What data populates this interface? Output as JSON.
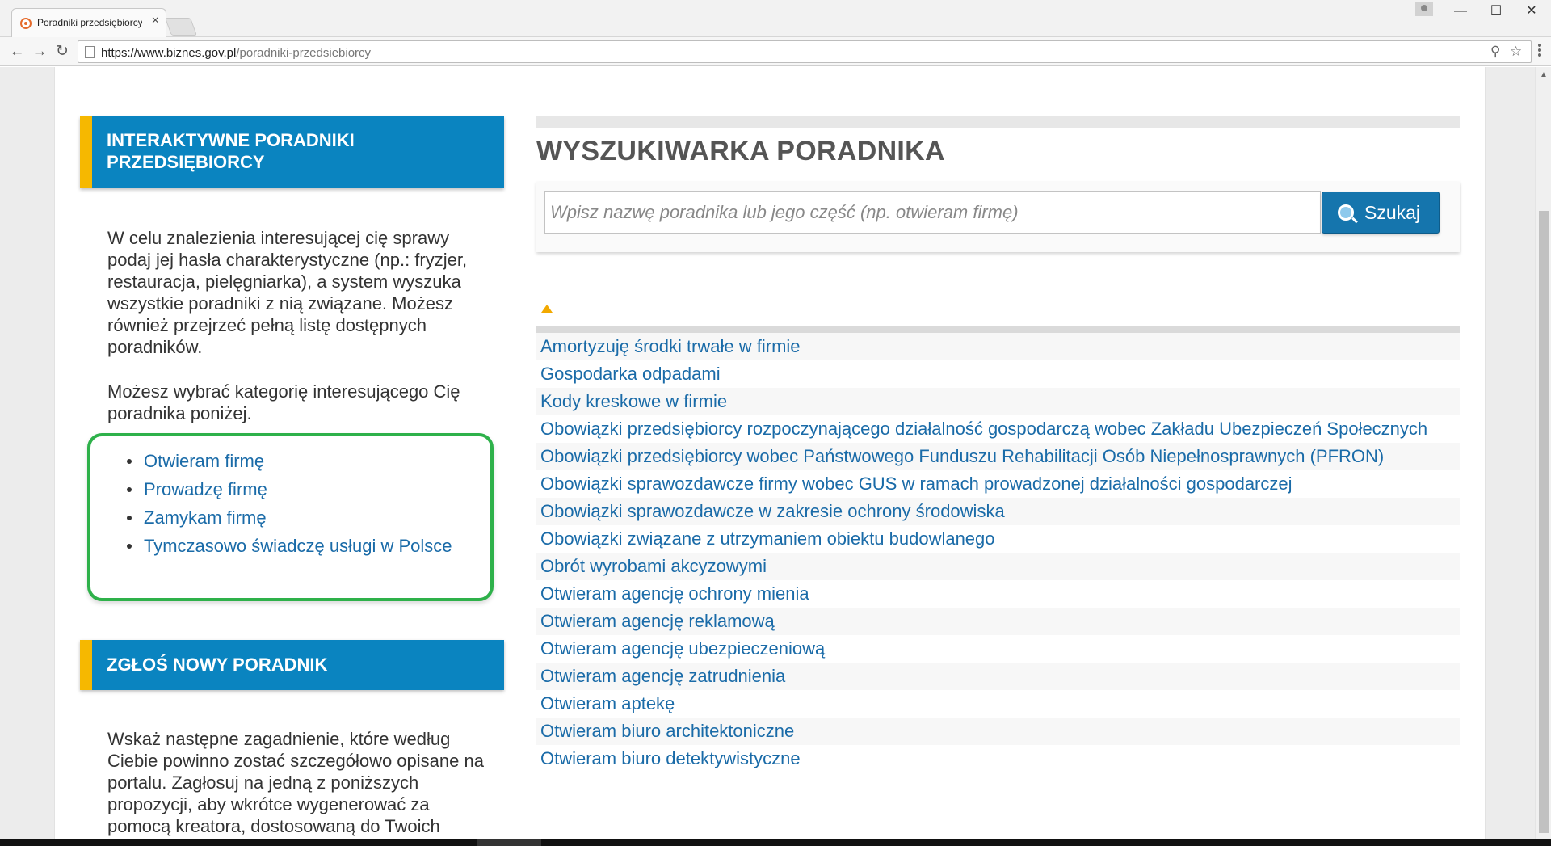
{
  "browser": {
    "tab_title": "Poradniki przedsiębiorcy |",
    "tab_close": "×",
    "url_host": "https://www.biznes.gov.pl",
    "url_path": "/poradniki-przedsiebiorcy",
    "back": "←",
    "forward": "→",
    "reload": "↻",
    "minimize": "—",
    "maximize": "☐",
    "close": "✕",
    "zoom_icon": "⚲",
    "star_icon": "☆"
  },
  "left": {
    "header1": "INTERAKTYWNE PORADNIKI PRZEDSIĘBIORCY",
    "intro": "W celu znalezienia interesującej cię sprawy podaj jej hasła charakterystyczne (np.: fryzjer, restauracja, pielęgniarka), a system wyszuka wszystkie poradniki z nią związane. Możesz również przejrzeć pełną listę dostępnych poradników.",
    "category_intro": "Możesz wybrać kategorię interesującego Cię poradnika poniżej.",
    "categories": [
      "Otwieram firmę",
      "Prowadzę firmę",
      "Zamykam firmę",
      "Tymczasowo świadczę usługi w Polsce"
    ],
    "header2": "ZGŁOŚ NOWY PORADNIK",
    "propose_text": "Wskaż następne zagadnienie, które według Ciebie powinno zostać szczegółowo opisane na portalu. Zagłosuj na jedną z poniższych propozycji, aby wkrótce wygenerować za pomocą kreatora, dostosowaną do Twoich"
  },
  "search": {
    "title": "WYSZUKIWARKA PORADNIKA",
    "placeholder": "Wpisz nazwę poradnika lub jego część (np. otwieram firmę)",
    "button_label": "Szukaj"
  },
  "guides": [
    "Amortyzuję środki trwałe w firmie",
    "Gospodarka odpadami",
    "Kody kreskowe w firmie",
    "Obowiązki przedsiębiorcy rozpoczynającego działalność gospodarczą wobec Zakładu Ubezpieczeń Społecznych",
    "Obowiązki przedsiębiorcy wobec Państwowego Funduszu Rehabilitacji Osób Niepełnosprawnych (PFRON)",
    "Obowiązki sprawozdawcze firmy wobec GUS w ramach prowadzonej działalności gospodarczej",
    "Obowiązki sprawozdawcze w zakresie ochrony środowiska",
    "Obowiązki związane z utrzymaniem obiektu budowlanego",
    "Obrót wyrobami akcyzowymi",
    "Otwieram agencję ochrony mienia",
    "Otwieram agencję reklamową",
    "Otwieram agencję ubezpieczeniową",
    "Otwieram agencję zatrudnienia",
    "Otwieram aptekę",
    "Otwieram biuro architektoniczne",
    "Otwieram biuro detektywistyczne"
  ]
}
